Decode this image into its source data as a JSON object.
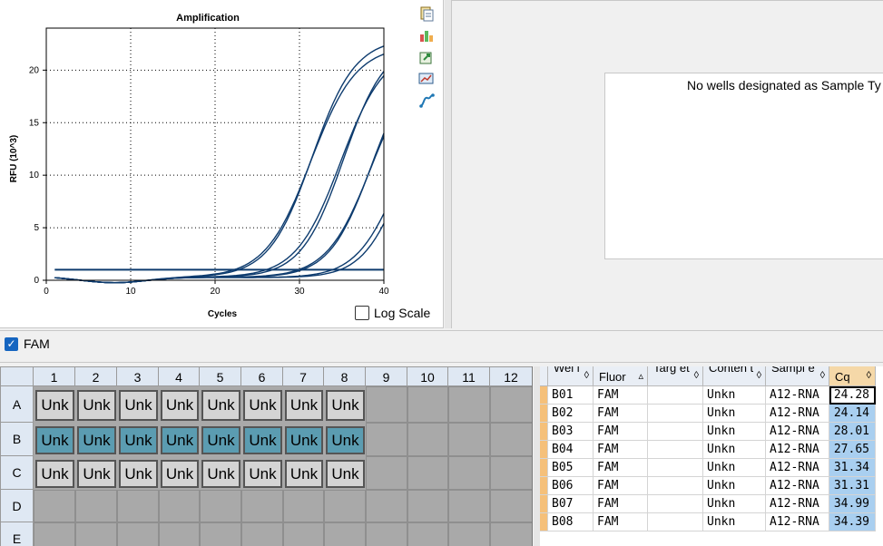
{
  "chart": {
    "title": "Amplification",
    "ylabel": "RFU (10^3)",
    "xlabel": "Cycles",
    "x_ticks": [
      "0",
      "10",
      "20",
      "30",
      "40"
    ],
    "y_ticks": [
      "0",
      "5",
      "10",
      "15",
      "20"
    ],
    "log_scale_label": "Log Scale",
    "log_scale_checked": false,
    "line_color": "#0d3b6e"
  },
  "chart_data": {
    "type": "line",
    "title": "Amplification",
    "xlabel": "Cycles",
    "ylabel": "RFU (10^3)",
    "xlim": [
      0,
      40
    ],
    "ylim": [
      0,
      24
    ],
    "grid": true,
    "series": [
      {
        "cq": 24.28,
        "plateau": 22.9,
        "k": 0.39
      },
      {
        "cq": 24.14,
        "plateau": 22.2,
        "k": 0.37
      },
      {
        "cq": 28.01,
        "plateau": 22.6,
        "k": 0.4
      },
      {
        "cq": 27.65,
        "plateau": 22.0,
        "k": 0.38
      },
      {
        "cq": 31.34,
        "plateau": 21.5,
        "k": 0.4
      },
      {
        "cq": 31.31,
        "plateau": 21.2,
        "k": 0.38
      },
      {
        "cq": 34.99,
        "plateau": 18.3,
        "k": 0.42
      },
      {
        "cq": 34.39,
        "plateau": 17.8,
        "k": 0.4
      }
    ],
    "threshold": 1.0
  },
  "toolbar_icons": [
    "copy-icon",
    "export-icon",
    "refresh-export-icon",
    "chart-settings-icon",
    "trace-icon"
  ],
  "right_panel": {
    "message": "No wells designated as Sample Ty"
  },
  "fluor": {
    "label": "FAM",
    "checked": true
  },
  "plate": {
    "columns": [
      "1",
      "2",
      "3",
      "4",
      "5",
      "6",
      "7",
      "8",
      "9",
      "10",
      "11",
      "12"
    ],
    "rows": [
      "A",
      "B",
      "C",
      "D",
      "E"
    ],
    "well_label": "Unk",
    "filled_rows": [
      "A",
      "B",
      "C"
    ],
    "filled_cols": 8,
    "selected_row": "B"
  },
  "table": {
    "headers": [
      "Wel l",
      "Fluor",
      "Targ et",
      "Conten t",
      "Sampl e",
      "Cq"
    ],
    "rows": [
      {
        "well": "B01",
        "fluor": "FAM",
        "target": "",
        "content": "Unkn",
        "sample": "A12-RNA",
        "cq": "24.28"
      },
      {
        "well": "B02",
        "fluor": "FAM",
        "target": "",
        "content": "Unkn",
        "sample": "A12-RNA",
        "cq": "24.14"
      },
      {
        "well": "B03",
        "fluor": "FAM",
        "target": "",
        "content": "Unkn",
        "sample": "A12-RNA",
        "cq": "28.01"
      },
      {
        "well": "B04",
        "fluor": "FAM",
        "target": "",
        "content": "Unkn",
        "sample": "A12-RNA",
        "cq": "27.65"
      },
      {
        "well": "B05",
        "fluor": "FAM",
        "target": "",
        "content": "Unkn",
        "sample": "A12-RNA",
        "cq": "31.34"
      },
      {
        "well": "B06",
        "fluor": "FAM",
        "target": "",
        "content": "Unkn",
        "sample": "A12-RNA",
        "cq": "31.31"
      },
      {
        "well": "B07",
        "fluor": "FAM",
        "target": "",
        "content": "Unkn",
        "sample": "A12-RNA",
        "cq": "34.99"
      },
      {
        "well": "B08",
        "fluor": "FAM",
        "target": "",
        "content": "Unkn",
        "sample": "A12-RNA",
        "cq": "34.39"
      }
    ]
  }
}
